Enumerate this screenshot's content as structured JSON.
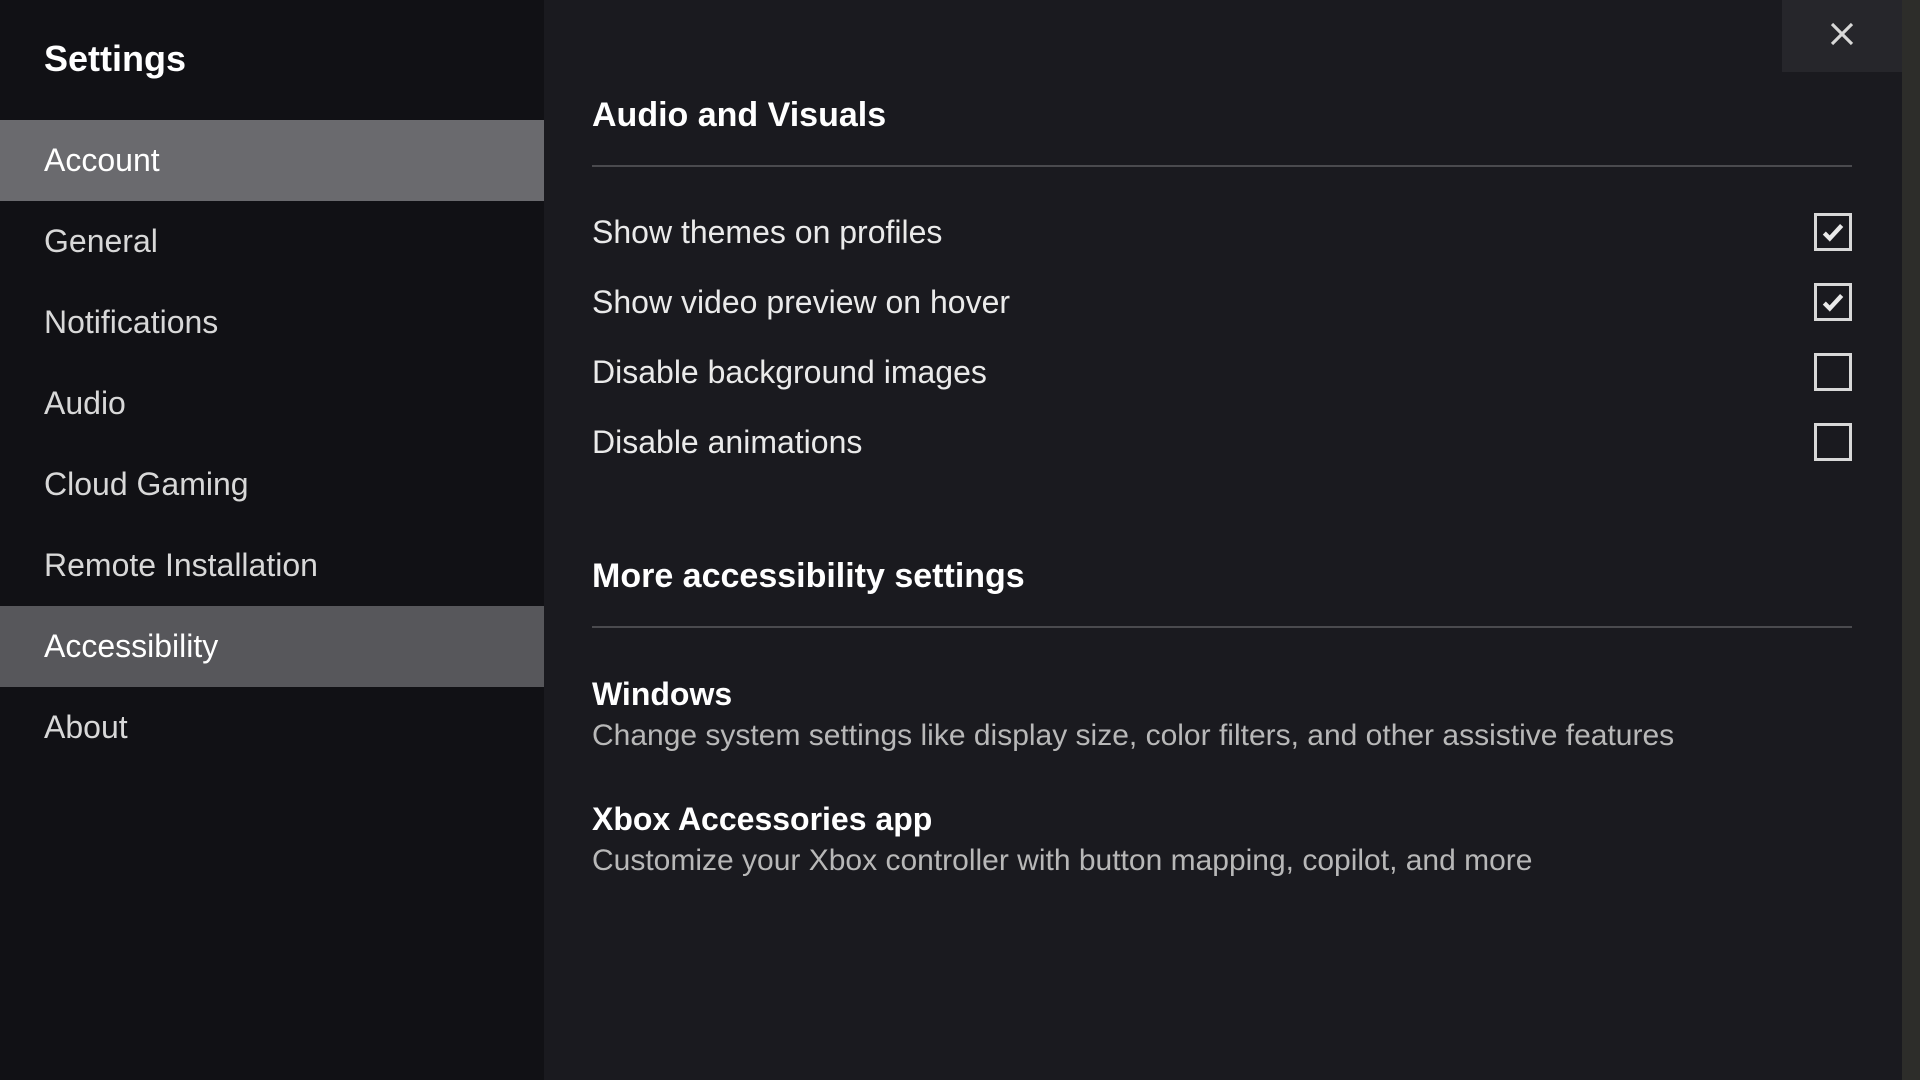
{
  "sidebar": {
    "title": "Settings",
    "items": [
      {
        "id": "account",
        "label": "Account",
        "state": "highlighted"
      },
      {
        "id": "general",
        "label": "General",
        "state": ""
      },
      {
        "id": "notifications",
        "label": "Notifications",
        "state": ""
      },
      {
        "id": "audio",
        "label": "Audio",
        "state": ""
      },
      {
        "id": "cloud-gaming",
        "label": "Cloud Gaming",
        "state": ""
      },
      {
        "id": "remote-installation",
        "label": "Remote Installation",
        "state": ""
      },
      {
        "id": "accessibility",
        "label": "Accessibility",
        "state": "selected"
      },
      {
        "id": "about",
        "label": "About",
        "state": ""
      }
    ]
  },
  "main": {
    "section1": {
      "header": "Audio and Visuals",
      "settings": [
        {
          "id": "show-themes",
          "label": "Show themes on profiles",
          "checked": true
        },
        {
          "id": "video-preview",
          "label": "Show video preview on hover",
          "checked": true
        },
        {
          "id": "disable-bg",
          "label": "Disable background images",
          "checked": false
        },
        {
          "id": "disable-anim",
          "label": "Disable animations",
          "checked": false
        }
      ]
    },
    "section2": {
      "header": "More accessibility settings",
      "links": [
        {
          "id": "windows",
          "title": "Windows",
          "desc": "Change system settings like display size, color filters, and other assistive features"
        },
        {
          "id": "xbox-accessories",
          "title": "Xbox Accessories app",
          "desc": "Customize your Xbox controller with button mapping, copilot, and more"
        }
      ]
    }
  }
}
